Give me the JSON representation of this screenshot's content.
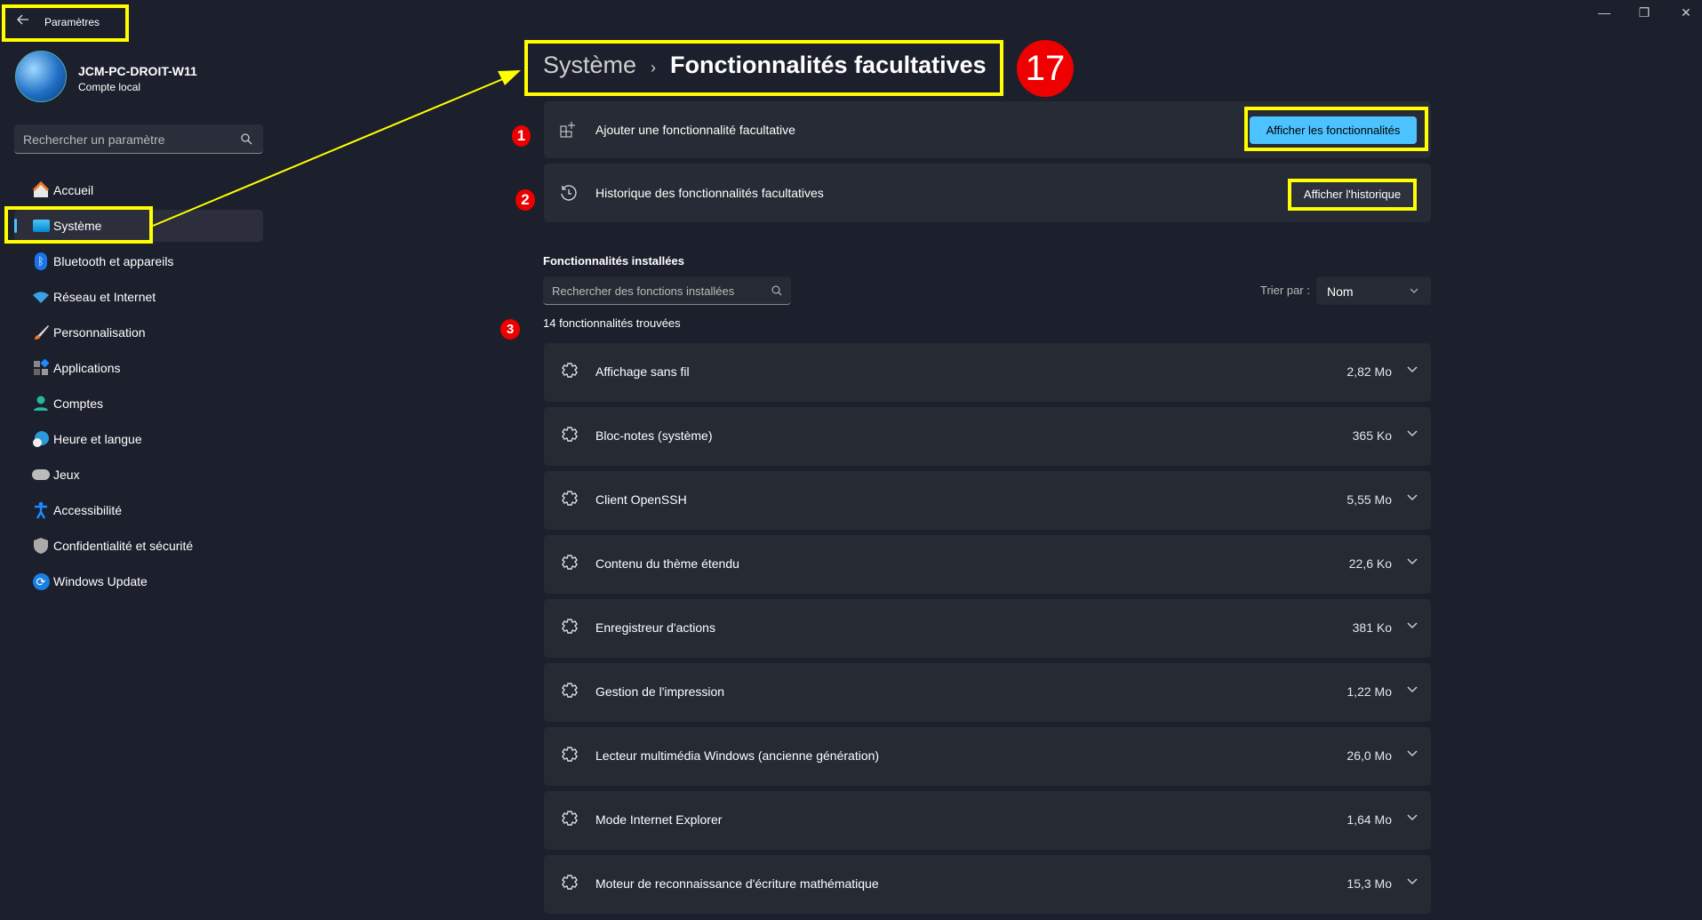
{
  "window": {
    "title": "Paramètres",
    "minimize": "—",
    "maximize": "❐",
    "close": "✕"
  },
  "user": {
    "name": "JCM-PC-DROIT-W11",
    "account": "Compte local"
  },
  "sidebar": {
    "search_placeholder": "Rechercher un paramètre",
    "items": [
      {
        "label": "Accueil",
        "icon": "home-icon"
      },
      {
        "label": "Système",
        "icon": "system-icon",
        "selected": true
      },
      {
        "label": "Bluetooth et appareils",
        "icon": "bluetooth-icon"
      },
      {
        "label": "Réseau et Internet",
        "icon": "wifi-icon"
      },
      {
        "label": "Personnalisation",
        "icon": "brush-icon"
      },
      {
        "label": "Applications",
        "icon": "apps-icon"
      },
      {
        "label": "Comptes",
        "icon": "person-icon"
      },
      {
        "label": "Heure et langue",
        "icon": "clock-globe-icon"
      },
      {
        "label": "Jeux",
        "icon": "gamepad-icon"
      },
      {
        "label": "Accessibilité",
        "icon": "accessibility-icon"
      },
      {
        "label": "Confidentialité et sécurité",
        "icon": "shield-icon"
      },
      {
        "label": "Windows Update",
        "icon": "update-icon"
      }
    ]
  },
  "breadcrumb": {
    "parent": "Système",
    "separator": "›",
    "current": "Fonctionnalités facultatives"
  },
  "annotations": {
    "step": "17",
    "m1": "1",
    "m2": "2",
    "m3": "3"
  },
  "add_card": {
    "label": "Ajouter une fonctionnalité facultative",
    "button": "Afficher les fonctionnalités"
  },
  "history_card": {
    "label": "Historique des fonctionnalités facultatives",
    "button": "Afficher l'historique"
  },
  "installed": {
    "title": "Fonctionnalités installées",
    "search_placeholder": "Rechercher des fonctions installées",
    "sort_label": "Trier par :",
    "sort_value": "Nom",
    "count": "14 fonctionnalités trouvées",
    "items": [
      {
        "name": "Affichage sans fil",
        "size": "2,82 Mo"
      },
      {
        "name": "Bloc-notes (système)",
        "size": "365 Ko"
      },
      {
        "name": "Client OpenSSH",
        "size": "5,55 Mo"
      },
      {
        "name": "Contenu du thème étendu",
        "size": "22,6 Ko"
      },
      {
        "name": "Enregistreur d'actions",
        "size": "381 Ko"
      },
      {
        "name": "Gestion de l'impression",
        "size": "1,22 Mo"
      },
      {
        "name": "Lecteur multimédia Windows (ancienne génération)",
        "size": "26,0 Mo"
      },
      {
        "name": "Mode Internet Explorer",
        "size": "1,64 Mo"
      },
      {
        "name": "Moteur de reconnaissance d'écriture mathématique",
        "size": "15,3 Mo"
      }
    ]
  },
  "colors": {
    "accent": "#4cc2ff",
    "highlight": "#ffff00",
    "marker": "#e00000"
  }
}
